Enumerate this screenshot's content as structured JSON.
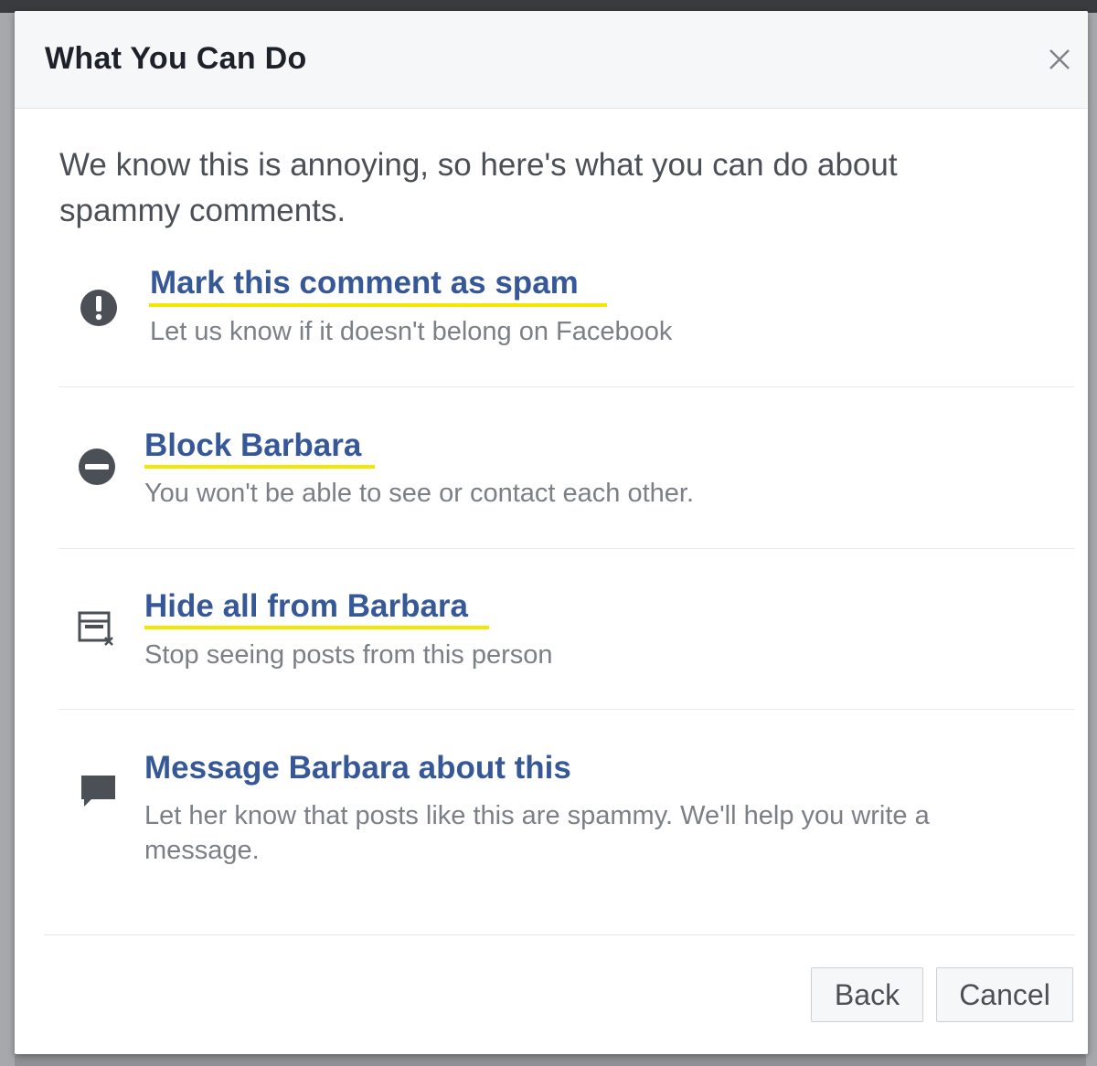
{
  "dialog": {
    "title": "What You Can Do",
    "intro": "We know this is annoying, so here's what you can do about spammy comments.",
    "options": [
      {
        "title": "Mark this comment as spam",
        "description": "Let us know if it doesn't belong on Facebook",
        "icon": "exclamation-circle-icon"
      },
      {
        "title": "Block Barbara",
        "description": "You won't be able to see or contact each other.",
        "icon": "block-icon"
      },
      {
        "title": "Hide all from Barbara",
        "description": "Stop seeing posts from this person",
        "icon": "hide-feed-icon"
      },
      {
        "title": "Message Barbara about this",
        "description": "Let her know that posts like this are spammy. We'll help you write a message.",
        "icon": "message-bubble-icon"
      }
    ],
    "buttons": {
      "back": "Back",
      "cancel": "Cancel"
    }
  },
  "colors": {
    "link": "#365899",
    "highlight": "#f5e600",
    "icon": "#4b4f56"
  }
}
